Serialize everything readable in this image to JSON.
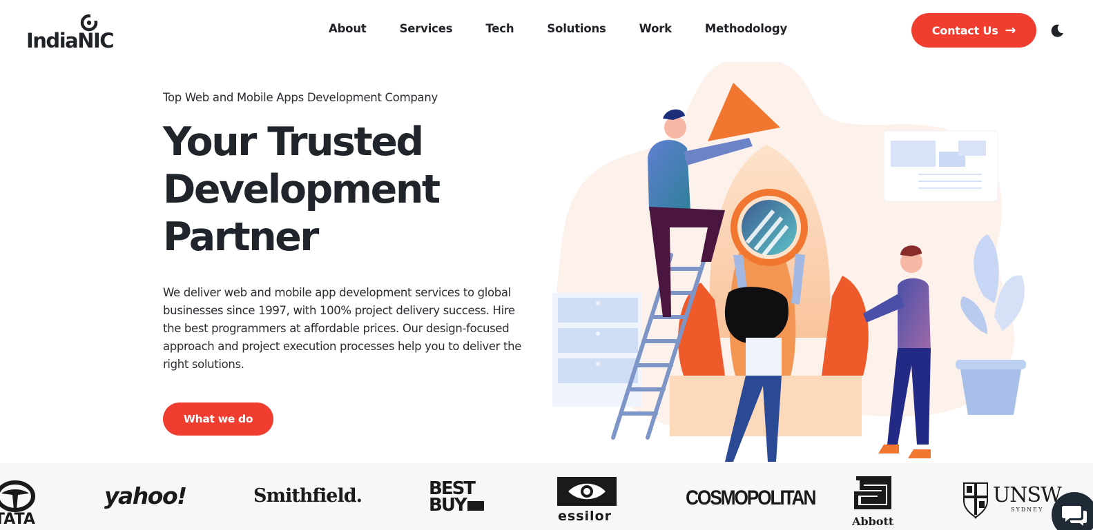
{
  "header": {
    "logo_text": "IndiaNIC",
    "nav": [
      "About",
      "Services",
      "Tech",
      "Solutions",
      "Work",
      "Methodology"
    ],
    "contact_label": "Contact Us",
    "contact_arrow": "→",
    "theme_icon": "moon-icon"
  },
  "hero": {
    "eyebrow": "Top Web and Mobile Apps Development Company",
    "title_lines": [
      "Your Trusted",
      "Development",
      "Partner"
    ],
    "description": "We deliver web and mobile app development services to global businesses since 1997, with 100% project delivery success. Hire the best programmers at affordable prices. Our design-focused approach and project execution processes help you to deliver the right solutions.",
    "cta_label": "What we do"
  },
  "clients": {
    "tata": "TATA",
    "yahoo": "yahoo!",
    "smithfield": "Smithfield.",
    "bestbuy_line1": "BEST",
    "bestbuy_line2": "BUY",
    "essilor": "essilor",
    "cosmopolitan": "COSMOPOLITAN",
    "abbott": "Abbott",
    "unsw": "UNSW",
    "unsw_sub": "SYDNEY"
  },
  "chat": {
    "icon": "chat-icon"
  },
  "colors": {
    "accent": "#f03d2f",
    "text_dark": "#20252b",
    "strip_bg": "#f6f7f9"
  }
}
